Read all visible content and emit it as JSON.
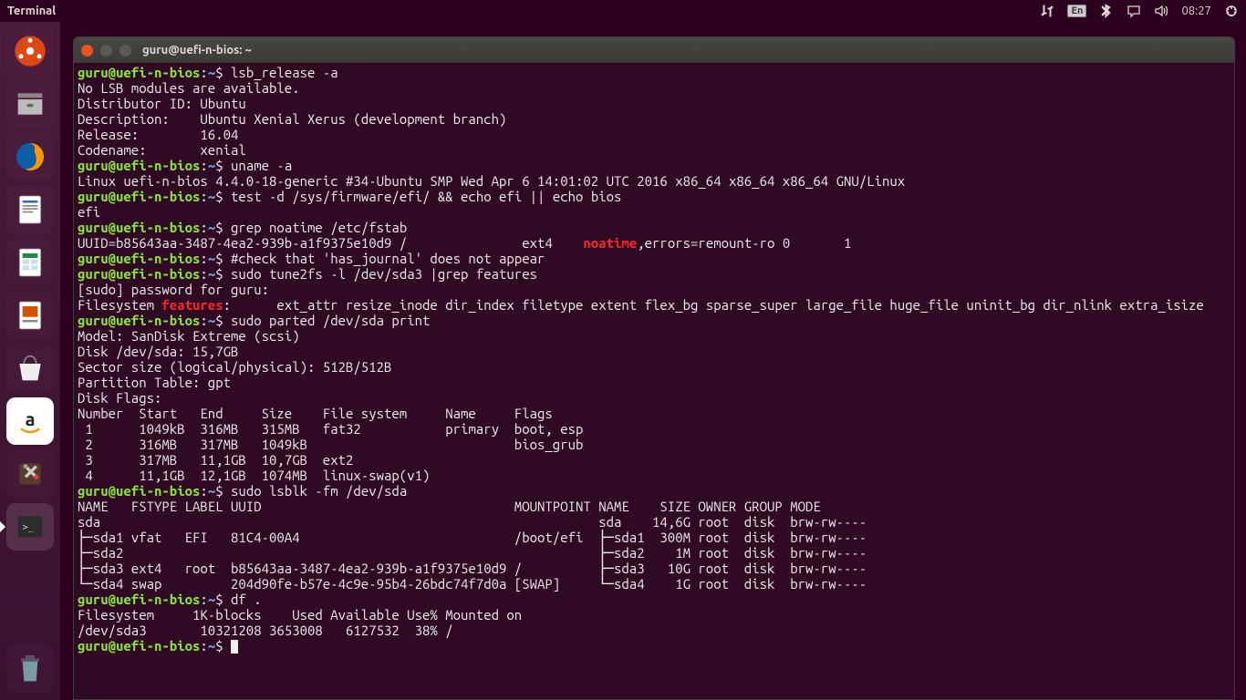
{
  "menubar": {
    "app_label": "Terminal",
    "lang": "En",
    "clock": "08:27"
  },
  "window": {
    "title": "guru@uefi-n-bios: ~"
  },
  "prompt": {
    "user_host": "guru@uefi-n-bios",
    "sep": ":",
    "path": "~",
    "sigil": "$ "
  },
  "launcher": {
    "items": [
      {
        "name": "dash",
        "active": false
      },
      {
        "name": "files",
        "active": false
      },
      {
        "name": "firefox",
        "active": false
      },
      {
        "name": "writer",
        "active": false
      },
      {
        "name": "calc",
        "active": false
      },
      {
        "name": "impress",
        "active": false
      },
      {
        "name": "software",
        "active": false
      },
      {
        "name": "amazon",
        "active": false
      },
      {
        "name": "settings",
        "active": false
      },
      {
        "name": "terminal",
        "active": true
      }
    ]
  },
  "lines": [
    {
      "type": "cmd",
      "cmd": "lsb_release -a"
    },
    {
      "type": "out",
      "text": "No LSB modules are available."
    },
    {
      "type": "out",
      "text": "Distributor ID: Ubuntu"
    },
    {
      "type": "out",
      "text": "Description:    Ubuntu Xenial Xerus (development branch)"
    },
    {
      "type": "out",
      "text": "Release:        16.04"
    },
    {
      "type": "out",
      "text": "Codename:       xenial"
    },
    {
      "type": "cmd",
      "cmd": "uname -a"
    },
    {
      "type": "out",
      "text": "Linux uefi-n-bios 4.4.0-18-generic #34-Ubuntu SMP Wed Apr 6 14:01:02 UTC 2016 x86_64 x86_64 x86_64 GNU/Linux"
    },
    {
      "type": "cmd",
      "cmd": "test -d /sys/firmware/efi/ && echo efi || echo bios"
    },
    {
      "type": "out",
      "text": "efi"
    },
    {
      "type": "cmd",
      "cmd": "grep noatime /etc/fstab"
    },
    {
      "type": "grepline",
      "pre": "UUID=b85643aa-3487-4ea2-939b-a1f9375e10d9 /               ext4    ",
      "hl": "noatime",
      "post": ",errors=remount-ro 0       1"
    },
    {
      "type": "cmd",
      "cmd": "#check that 'has_journal' does not appear"
    },
    {
      "type": "cmd",
      "cmd": "sudo tune2fs -l /dev/sda3 |grep features"
    },
    {
      "type": "out",
      "text": "[sudo] password for guru: "
    },
    {
      "type": "grepline",
      "pre": "Filesystem ",
      "hl": "features",
      "post": ":      ext_attr resize_inode dir_index filetype extent flex_bg sparse_super large_file huge_file uninit_bg dir_nlink extra_isize"
    },
    {
      "type": "cmd",
      "cmd": "sudo parted /dev/sda print"
    },
    {
      "type": "out",
      "text": "Model: SanDisk Extreme (scsi)"
    },
    {
      "type": "out",
      "text": "Disk /dev/sda: 15,7GB"
    },
    {
      "type": "out",
      "text": "Sector size (logical/physical): 512B/512B"
    },
    {
      "type": "out",
      "text": "Partition Table: gpt"
    },
    {
      "type": "out",
      "text": "Disk Flags: "
    },
    {
      "type": "out",
      "text": ""
    },
    {
      "type": "out",
      "text": "Number  Start   End     Size    File system     Name     Flags"
    },
    {
      "type": "out",
      "text": " 1      1049kB  316MB   315MB   fat32           primary  boot, esp"
    },
    {
      "type": "out",
      "text": " 2      316MB   317MB   1049kB                           bios_grub"
    },
    {
      "type": "out",
      "text": " 3      317MB   11,1GB  10,7GB  ext2"
    },
    {
      "type": "out",
      "text": " 4      11,1GB  12,1GB  1074MB  linux-swap(v1)"
    },
    {
      "type": "out",
      "text": ""
    },
    {
      "type": "cmd",
      "cmd": "sudo lsblk -fm /dev/sda"
    },
    {
      "type": "out",
      "text": "NAME   FSTYPE LABEL UUID                                 MOUNTPOINT NAME    SIZE OWNER GROUP MODE"
    },
    {
      "type": "out",
      "text": "sda                                                                 sda    14,6G root  disk  brw-rw----"
    },
    {
      "type": "out",
      "text": "├─sda1 vfat   EFI   81C4-00A4                            /boot/efi  ├─sda1  300M root  disk  brw-rw----"
    },
    {
      "type": "out",
      "text": "├─sda2                                                              ├─sda2    1M root  disk  brw-rw----"
    },
    {
      "type": "out",
      "text": "├─sda3 ext4   root  b85643aa-3487-4ea2-939b-a1f9375e10d9 /          ├─sda3   10G root  disk  brw-rw----"
    },
    {
      "type": "out",
      "text": "└─sda4 swap         204d90fe-b57e-4c9e-95b4-26bdc74f7d0a [SWAP]     └─sda4    1G root  disk  brw-rw----"
    },
    {
      "type": "cmd",
      "cmd": "df ."
    },
    {
      "type": "out",
      "text": "Filesystem     1K-blocks    Used Available Use% Mounted on"
    },
    {
      "type": "out",
      "text": "/dev/sda3       10321208 3653008   6127532  38% /"
    },
    {
      "type": "cmd",
      "cmd": "",
      "cursor": true
    }
  ]
}
